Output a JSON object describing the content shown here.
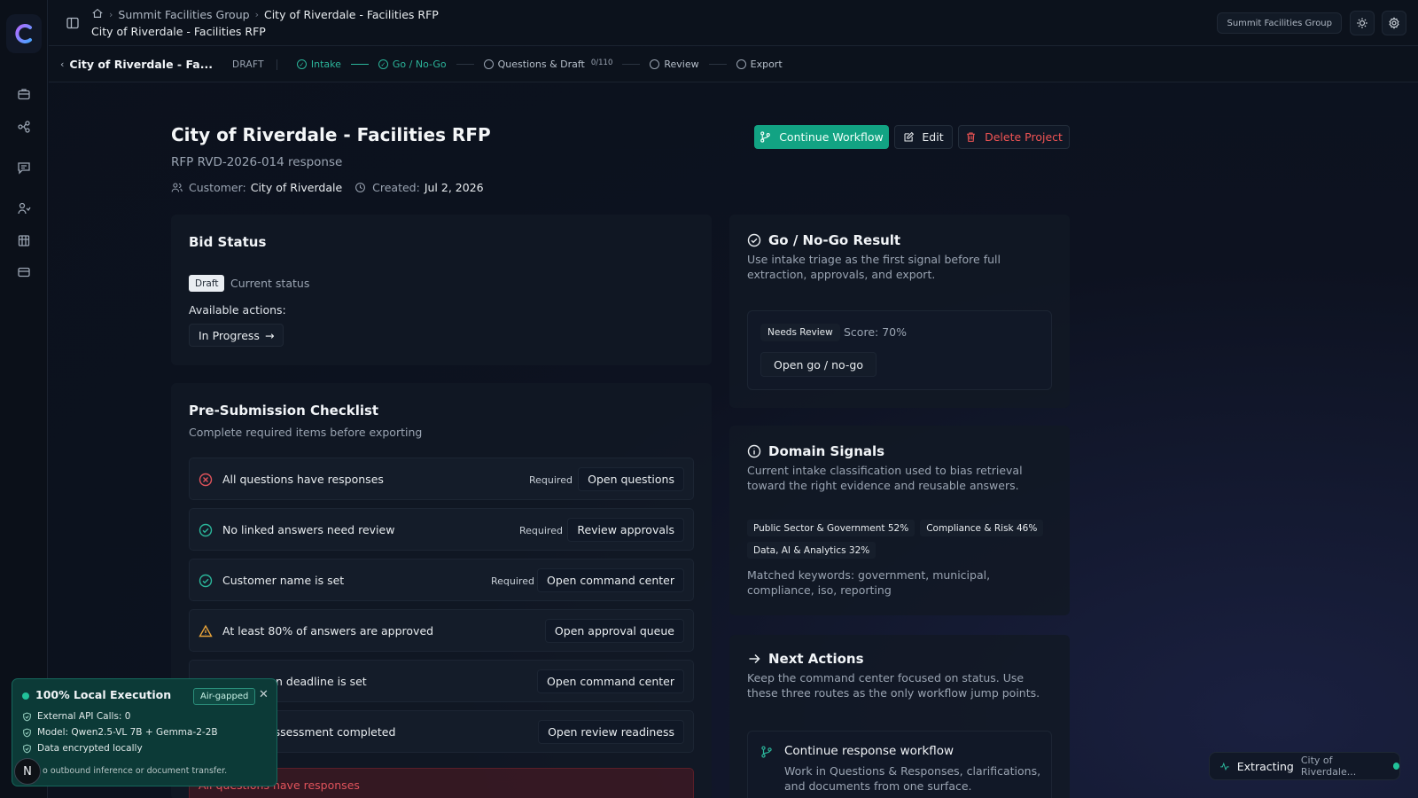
{
  "breadcrumb": {
    "org": "Summit Facilities Group",
    "current": "City of Riverdale - Facilities RFP"
  },
  "page_subtitle": "City of Riverdale - Facilities RFP",
  "org_pill": "Summit Facilities Group",
  "stepbar": {
    "project": "City of Riverdale - Fa...",
    "status": "DRAFT",
    "steps": [
      {
        "label": "Intake",
        "state": "done"
      },
      {
        "label": "Go / No-Go",
        "state": "done"
      },
      {
        "label": "Questions & Draft",
        "state": "todo",
        "count": "0/110"
      },
      {
        "label": "Review",
        "state": "todo"
      },
      {
        "label": "Export",
        "state": "todo"
      }
    ]
  },
  "project": {
    "title": "City of Riverdale - Facilities RFP",
    "subtitle": "RFP RVD-2026-014 response",
    "customer_label": "Customer:",
    "customer": "City of Riverdale",
    "created_label": "Created:",
    "created": "Jul 2, 2026"
  },
  "actions": {
    "continue": "Continue Workflow",
    "edit": "Edit",
    "delete": "Delete Project"
  },
  "bid_status": {
    "title": "Bid Status",
    "badge": "Draft",
    "current": "Current status",
    "available_label": "Available actions:",
    "action": "In Progress"
  },
  "checklist": {
    "title": "Pre-Submission Checklist",
    "desc": "Complete required items before exporting",
    "items": [
      {
        "text": "All questions have responses",
        "required": "Required",
        "button": "Open questions",
        "state": "error"
      },
      {
        "text": "No linked answers need review",
        "required": "Required",
        "button": "Review approvals",
        "state": "ok"
      },
      {
        "text": "Customer name is set",
        "required": "Required",
        "button": "Open command center",
        "state": "ok"
      },
      {
        "text": "At least 80% of answers are approved",
        "required": "",
        "button": "Open approval queue",
        "state": "warn"
      },
      {
        "text": "n deadline is set",
        "required": "",
        "button": "Open command center",
        "state": "hidden"
      },
      {
        "text": "assessment completed",
        "required": "",
        "button": "Open review readiness",
        "state": "hidden"
      }
    ],
    "error_banner": "All questions have responses"
  },
  "gonogo": {
    "title": "Go / No-Go Result",
    "desc": "Use intake triage as the first signal before full extraction, approvals, and export.",
    "status": "Needs Review",
    "score": "Score: 70%",
    "button": "Open go / no-go"
  },
  "domain": {
    "title": "Domain Signals",
    "desc": "Current intake classification used to bias retrieval toward the right evidence and reusable answers.",
    "tags": [
      "Public Sector & Government 52%",
      "Compliance & Risk 46%",
      "Data, AI & Analytics 32%"
    ],
    "keywords": "Matched keywords: government, municipal, compliance, iso, reporting"
  },
  "next_actions": {
    "title": "Next Actions",
    "desc": "Keep the command center focused on status. Use these three routes as the only workflow jump points.",
    "item_title": "Continue response workflow",
    "item_desc": "Work in Questions & Responses, clarifications, and documents from one surface."
  },
  "local_exec": {
    "title": "100% Local Execution",
    "badge": "Air-gapped",
    "lines": [
      "External API Calls: 0",
      "Model: Qwen2.5-VL 7B + Gemma-2-2B",
      "Data encrypted locally"
    ],
    "footer": "o outbound inference or document transfer."
  },
  "avatar_letter": "N",
  "extracting": {
    "label": "Extracting",
    "name": "City of Riverdale..."
  },
  "colors": {
    "accent": "#12a383",
    "danger": "#f05454",
    "warning": "#e8a33a",
    "success": "#2bb59a"
  }
}
